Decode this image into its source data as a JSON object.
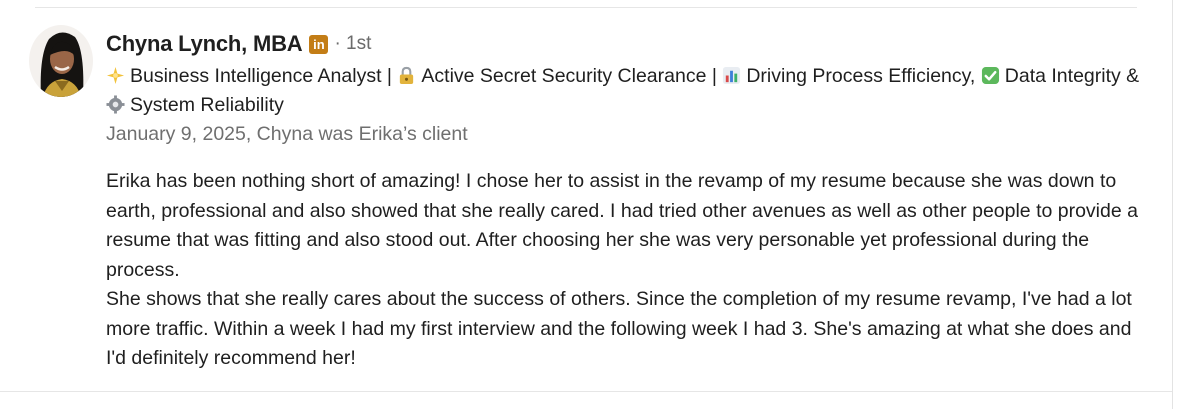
{
  "recommendation": {
    "author": {
      "name": "Chyna Lynch, MBA",
      "linkedin_badge": "in",
      "connection_degree": "· 1st"
    },
    "headline": {
      "parts": [
        {
          "icon": "sparkle-icon",
          "text": "Business Intelligence Analyst | "
        },
        {
          "icon": "lock-icon",
          "text": "Active Secret Security Clearance | "
        },
        {
          "icon": "bar-chart-icon",
          "text": "Driving Process Efficiency, "
        },
        {
          "icon": "check-mark-icon",
          "text": "Data Integrity & "
        },
        {
          "icon": "gear-icon",
          "text": "System Reliability"
        }
      ]
    },
    "meta": "January 9, 2025, Chyna was Erika’s client",
    "body": {
      "paragraph_1": "Erika has been nothing short of amazing! I chose her to assist in the revamp of my resume because she was down to earth, professional and also showed that she really cared. I had tried other avenues as well as other people to provide a resume that was fitting and also stood out. After choosing her she was very personable yet professional during the process.",
      "paragraph_2": "She shows that she really cares about the success of others. Since the completion of my resume revamp, I've had a lot more traffic. Within a week I had my first interview and the following week I had 3. She's amazing at what she does and I'd definitely recommend her!"
    }
  },
  "colors": {
    "text_primary": "#1f1f1f",
    "text_secondary": "#6f6f6f",
    "linkedin_badge": "#c37d16",
    "check_mark": "#5cb85c",
    "divider": "#e6e6e6"
  }
}
